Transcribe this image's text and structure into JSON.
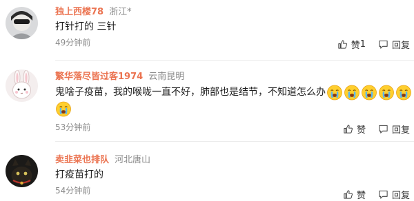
{
  "comments": [
    {
      "username": "独上西楼78",
      "location": "浙江*",
      "text": "打针打的 三针",
      "time": "49分钟前",
      "like_label": "赞",
      "like_count": "1",
      "reply_label": "回复"
    },
    {
      "username": "繁华落尽皆过客1974",
      "location": "云南昆明",
      "text": "鬼啥子疫苗，我的喉咙一直不好，肺部也是结节，不知道怎么办",
      "time": "53分钟前",
      "like_label": "赞",
      "like_count": "",
      "reply_label": "回复",
      "emoji_icon": "crying-emoji-icon"
    },
    {
      "username": "卖韭菜也排队",
      "location": "河北唐山",
      "text": "打疫苗打的",
      "time": "54分钟前",
      "like_label": "赞",
      "like_count": "",
      "reply_label": "回复"
    }
  ],
  "colors": {
    "username": "#eb7350",
    "meta": "#8a8a8a",
    "text": "#1f1f1f"
  }
}
